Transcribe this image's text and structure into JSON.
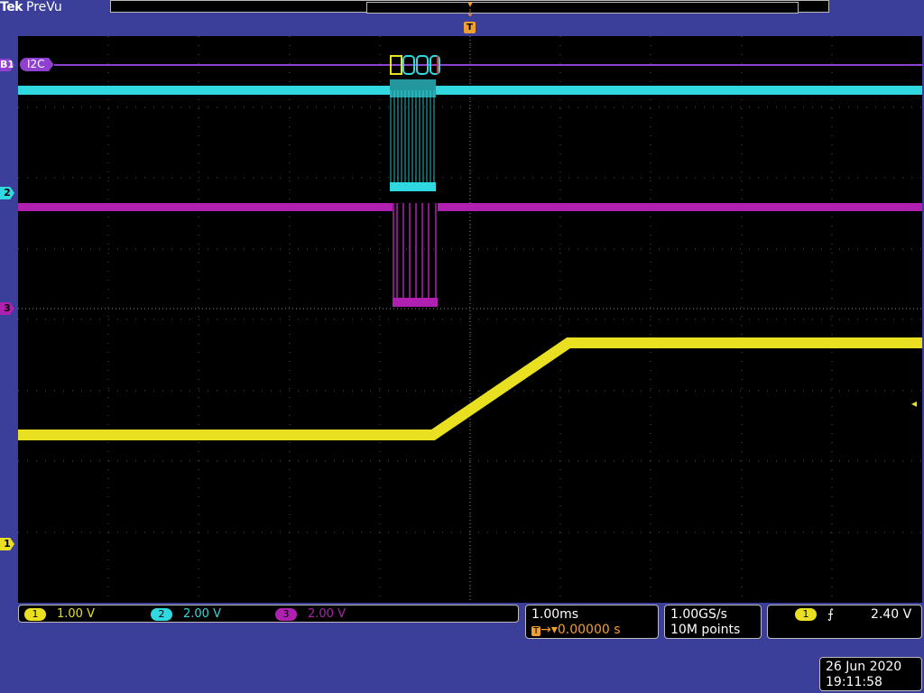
{
  "header": {
    "brand": "Tek",
    "mode": "PreVu",
    "trigger_marker": "T"
  },
  "markers": {
    "bus": "B1",
    "ch2": "2",
    "ch3": "3",
    "ch1": "1"
  },
  "bus": {
    "label": "I2C",
    "decode": "0",
    "decode2": "0",
    "decode3": "0"
  },
  "channels": [
    {
      "num": "1",
      "scale": "1.00 V",
      "color": "#e8e020"
    },
    {
      "num": "2",
      "scale": "2.00 V",
      "color": "#30d8e0"
    },
    {
      "num": "3",
      "scale": "2.00 V",
      "color": "#b020b0"
    }
  ],
  "timebase": {
    "scale": "1.00ms",
    "position_prefix": "T",
    "position": "0.00000 s"
  },
  "acquisition": {
    "sample_rate": "1.00GS/s",
    "record_length": "10M points"
  },
  "trigger": {
    "source": "1",
    "slope_icon": "rising-edge-icon",
    "slope_glyph": "⨍",
    "level": "2.40 V"
  },
  "clock": {
    "date": "26 Jun 2020",
    "time": "19:11:58"
  },
  "colors": {
    "background": "#3c3f9a",
    "screen": "#000000",
    "ch1": "#e8e020",
    "ch2": "#30d8e0",
    "ch3": "#b020b0",
    "bus": "#9040d0",
    "trigger": "#f0a030"
  }
}
